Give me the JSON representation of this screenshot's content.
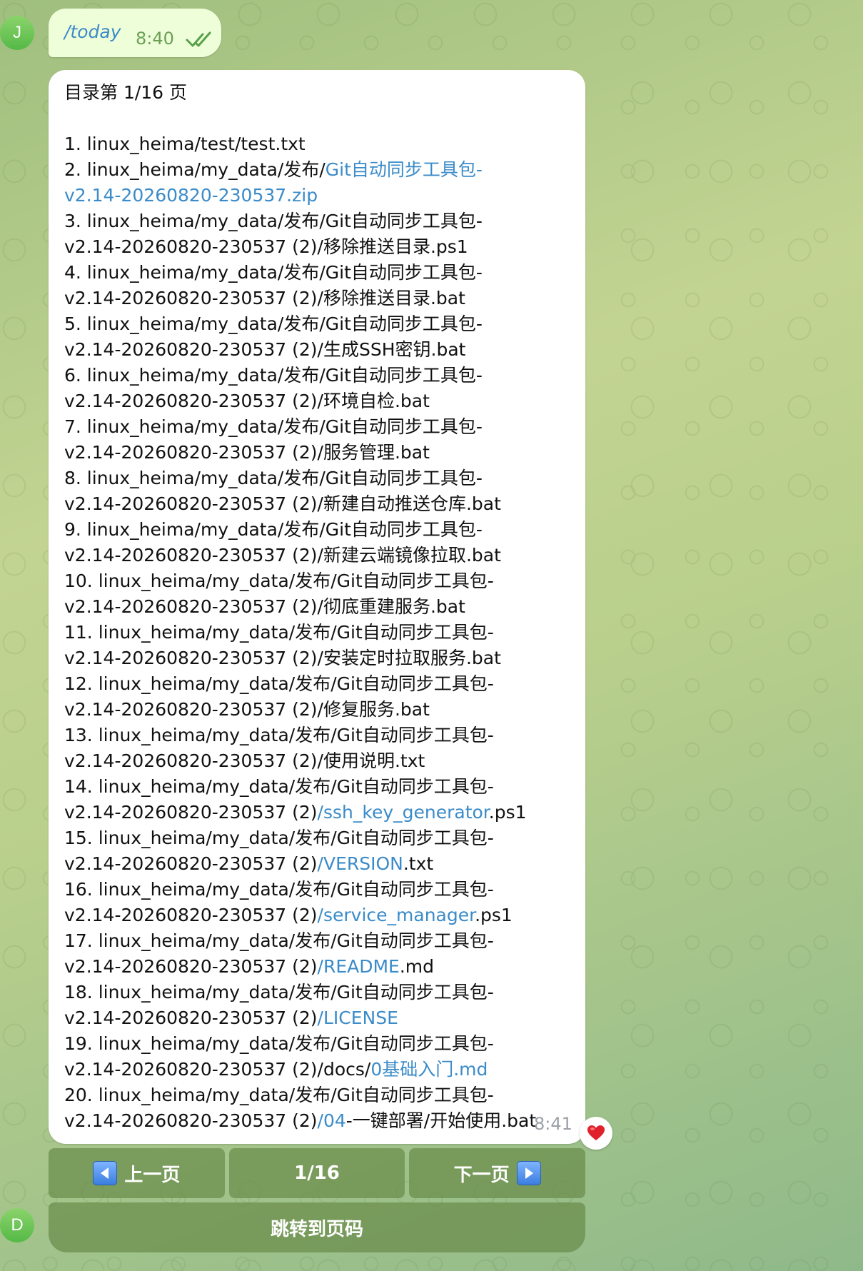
{
  "avatars": {
    "user": "J",
    "bot": "D"
  },
  "command_message": {
    "text": "/today",
    "time": "8:40",
    "status_icon": "double-check-icon"
  },
  "bot_message": {
    "header": "目录第 1/16 页",
    "items": [
      [
        {
          "t": "1. linux_heima/test/test.txt",
          "link": false
        }
      ],
      [
        {
          "t": "2. linux_heima/my_data/发布/",
          "link": false
        },
        {
          "t": "Git自动同步工具包-\nv2.14-20260820-230537.zip",
          "link": true
        }
      ],
      [
        {
          "t": "3. linux_heima/my_data/发布/Git自动同步工具包-\nv2.14-20260820-230537 (2)/移除推送目录.ps1",
          "link": false
        }
      ],
      [
        {
          "t": "4. linux_heima/my_data/发布/Git自动同步工具包-\nv2.14-20260820-230537 (2)/移除推送目录.bat",
          "link": false
        }
      ],
      [
        {
          "t": "5. linux_heima/my_data/发布/Git自动同步工具包-\nv2.14-20260820-230537 (2)/生成SSH密钥.bat",
          "link": false
        }
      ],
      [
        {
          "t": "6. linux_heima/my_data/发布/Git自动同步工具包-\nv2.14-20260820-230537 (2)/环境自检.bat",
          "link": false
        }
      ],
      [
        {
          "t": "7. linux_heima/my_data/发布/Git自动同步工具包-\nv2.14-20260820-230537 (2)/服务管理.bat",
          "link": false
        }
      ],
      [
        {
          "t": "8. linux_heima/my_data/发布/Git自动同步工具包-\nv2.14-20260820-230537 (2)/新建自动推送仓库.bat",
          "link": false
        }
      ],
      [
        {
          "t": "9. linux_heima/my_data/发布/Git自动同步工具包-\nv2.14-20260820-230537 (2)/新建云端镜像拉取.bat",
          "link": false
        }
      ],
      [
        {
          "t": "10. linux_heima/my_data/发布/Git自动同步工具包-\nv2.14-20260820-230537 (2)/彻底重建服务.bat",
          "link": false
        }
      ],
      [
        {
          "t": "11. linux_heima/my_data/发布/Git自动同步工具包-\nv2.14-20260820-230537 (2)/安装定时拉取服务.bat",
          "link": false
        }
      ],
      [
        {
          "t": "12. linux_heima/my_data/发布/Git自动同步工具包-\nv2.14-20260820-230537 (2)/修复服务.bat",
          "link": false
        }
      ],
      [
        {
          "t": "13. linux_heima/my_data/发布/Git自动同步工具包-\nv2.14-20260820-230537 (2)/使用说明.txt",
          "link": false
        }
      ],
      [
        {
          "t": "14. linux_heima/my_data/发布/Git自动同步工具包-\nv2.14-20260820-230537 (2)",
          "link": false
        },
        {
          "t": "/ssh_key_generator",
          "link": true
        },
        {
          "t": ".ps1",
          "link": false
        }
      ],
      [
        {
          "t": "15. linux_heima/my_data/发布/Git自动同步工具包-\nv2.14-20260820-230537 (2)",
          "link": false
        },
        {
          "t": "/VERSION",
          "link": true
        },
        {
          "t": ".txt",
          "link": false
        }
      ],
      [
        {
          "t": "16. linux_heima/my_data/发布/Git自动同步工具包-\nv2.14-20260820-230537 (2)",
          "link": false
        },
        {
          "t": "/service_manager",
          "link": true
        },
        {
          "t": ".ps1",
          "link": false
        }
      ],
      [
        {
          "t": "17. linux_heima/my_data/发布/Git自动同步工具包-\nv2.14-20260820-230537 (2)",
          "link": false
        },
        {
          "t": "/README",
          "link": true
        },
        {
          "t": ".md",
          "link": false
        }
      ],
      [
        {
          "t": "18. linux_heima/my_data/发布/Git自动同步工具包-\nv2.14-20260820-230537 (2)",
          "link": false
        },
        {
          "t": "/LICENSE",
          "link": true
        }
      ],
      [
        {
          "t": "19. linux_heima/my_data/发布/Git自动同步工具包-\nv2.14-20260820-230537 (2)/docs/",
          "link": false
        },
        {
          "t": "0基础入门.md",
          "link": true
        }
      ],
      [
        {
          "t": "20. linux_heima/my_data/发布/Git自动同步工具包-\nv2.14-20260820-230537 (2)",
          "link": false
        },
        {
          "t": "/04",
          "link": true
        },
        {
          "t": "-一键部署/开始使用.bat",
          "link": false
        }
      ]
    ],
    "time": "8:41",
    "reaction": "heart-icon"
  },
  "keyboard": {
    "prev_label": "上一页",
    "page_label": "1/16",
    "next_label": "下一页",
    "jump_label": "跳转到页码"
  },
  "colors": {
    "link": "#3a8bc9",
    "button_bg": "#6a8c4a",
    "command_bubble": "#eefed9",
    "check": "#5aa04a"
  }
}
